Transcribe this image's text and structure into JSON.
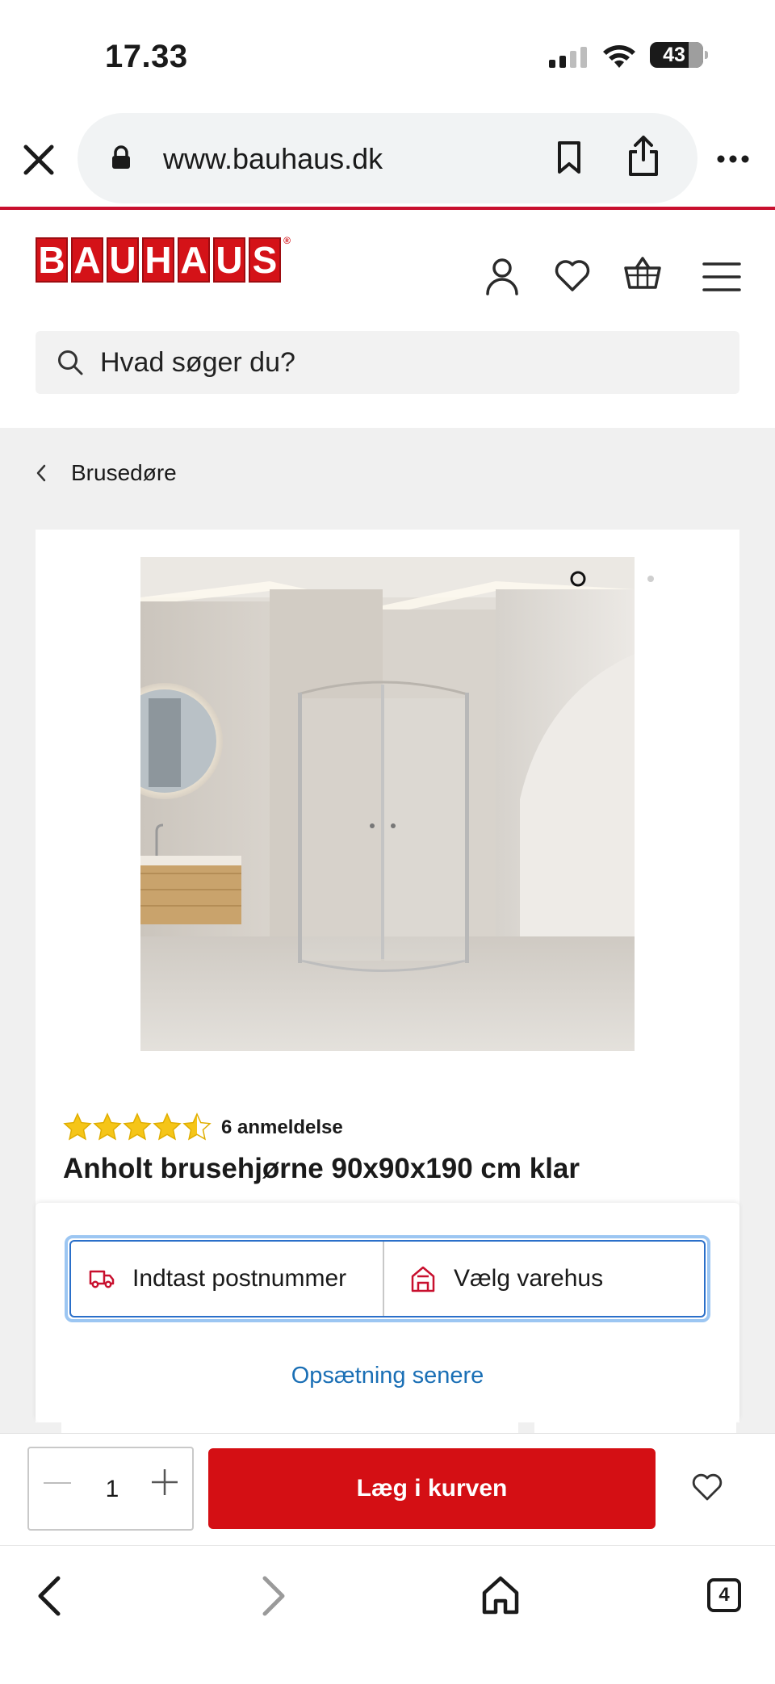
{
  "status_bar": {
    "time": "17.33",
    "battery": "43"
  },
  "browser": {
    "url": "www.bauhaus.dk"
  },
  "header": {
    "logo_letters": [
      "B",
      "A",
      "U",
      "H",
      "A",
      "U",
      "S"
    ],
    "search_placeholder": "Hvad søger du?"
  },
  "breadcrumb": {
    "label": "Brusedøre"
  },
  "product": {
    "rating": 4.5,
    "reviews_label": "6 anmeldelse",
    "title": "Anholt brusehjørne 90x90x190 cm klar",
    "image_count": 2,
    "active_image": 1
  },
  "delivery": {
    "postcode_label": "Indtast postnummer",
    "store_label": "Vælg varehus",
    "later_label": "Opsætning senere"
  },
  "buy": {
    "quantity": "1",
    "add_to_cart_label": "Læg i kurven"
  },
  "safari": {
    "tab_count": "4"
  },
  "colors": {
    "brand_red": "#d40f14",
    "link_blue": "#1a6fb5",
    "star": "#f5c518"
  }
}
